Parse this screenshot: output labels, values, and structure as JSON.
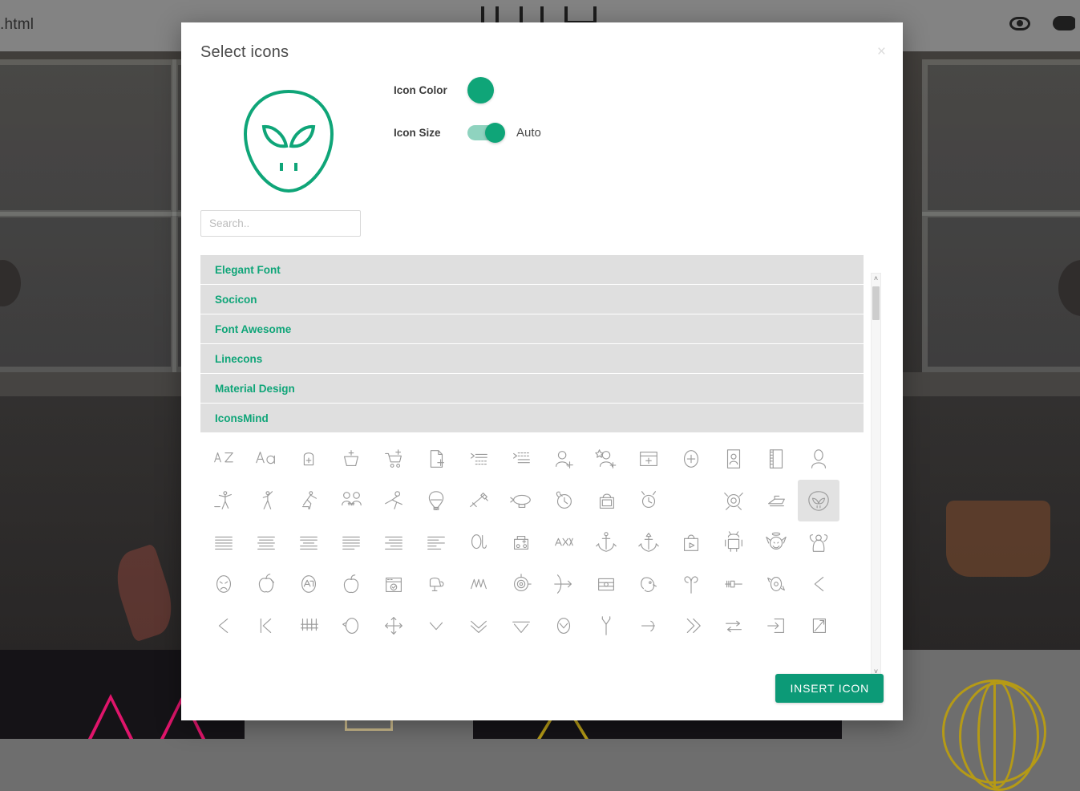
{
  "background": {
    "browser_title": ".html",
    "device_icons": [
      "mobile-preview-icon",
      "tablet-preview-icon",
      "desktop-preview-icon"
    ],
    "toolbar_icons": [
      "eye-icon",
      "cloud-icon"
    ]
  },
  "modal": {
    "title": "Select icons",
    "close_label": "×",
    "preview": {
      "icon_name": "alien-icon",
      "color": "#0fa578"
    },
    "options": {
      "color_label": "Icon Color",
      "color_value": "#0fa578",
      "size_label": "Icon Size",
      "size_value": "Auto",
      "size_toggle_on": true
    },
    "search": {
      "placeholder": "Search..",
      "value": ""
    },
    "categories": [
      {
        "label": "Elegant Font"
      },
      {
        "label": "Socicon"
      },
      {
        "label": "Font Awesome"
      },
      {
        "label": "Linecons"
      },
      {
        "label": "Material Design"
      },
      {
        "label": "IconsMind"
      }
    ],
    "icon_grid": {
      "selected_index": 29,
      "icons": [
        "a-to-z-sort-icon",
        "font-size-icon",
        "add-bag-icon",
        "add-basket-icon",
        "add-cart-icon",
        "add-file-icon",
        "add-space-before-paragraph-icon",
        "add-space-after-paragraph-icon",
        "add-user-icon",
        "add-favorite-user-icon",
        "add-window-icon",
        "add-circle-icon",
        "address-book-icon",
        "agenda-icon",
        "administrator-icon",
        "aerobics-icon",
        "aerobics-2-icon",
        "aerobics-3-icon",
        "affiliate-icon",
        "air-balloon-icon",
        "hot-air-balloon-icon",
        "airship-icon",
        "aircraft-icon",
        "alarm-clock-icon",
        "alarm-bag-icon",
        "alarm-clock-2-icon",
        "alien-icon",
        "alien-2-icon",
        "alien-ship-icon",
        "align-justify-all-icon",
        "align-justify-all-2-icon",
        "align-justify-center-icon",
        "align-justify-high-icon",
        "align-justify-low-icon",
        "align-justify-right-icon",
        "align-left-icon",
        "align-right-icon",
        "alpha-icon",
        "ambulance-icon",
        "amx-icon",
        "anchor-icon",
        "anchor-2-icon",
        "android-store-icon",
        "android-icon",
        "angel-smile-icon",
        "angel-icon",
        "angry-icon",
        "apple-bite-icon",
        "apple-store-icon",
        "apple-icon",
        "approved-window-icon",
        "aquarius-icon",
        "arrow-around-icon",
        "archery-icon",
        "archery-2-icon",
        "argentina-icon",
        "aries-icon",
        "arrow-back-icon",
        "arrow-refresh-icon",
        "arrow-left-icon",
        "arrow-back-3-icon",
        "arrow-back-2-icon",
        "arrow-barrier-icon",
        "arrow-circle-icon",
        "arrow-cross-icon",
        "arrow-down-icon",
        "arrow-down-2-icon",
        "arrow-down-3-icon",
        "arrow-down-in-circle-icon",
        "arrow-fork-icon",
        "arrow-forward-icon",
        "arrow-forward-2-icon",
        "arrow-turn-right-icon",
        "arrow-into-icon",
        "arrow-inside-icon",
        "arrow-next-icon",
        "arrow-slash-icon",
        "arrow-merge-icon",
        "arrow-slash-2-icon",
        "arrow-double-slash-icon",
        "arrow-over-icon",
        "arrow-turn-icon",
        "arrow-dot-icon",
        "arrow-in-out-icon",
        "arrow-parallel-icon",
        "arrow-corner-icon"
      ]
    },
    "scrollbar": {
      "up_arrow": "˄",
      "down_arrow": "˅"
    },
    "insert_button_label": "INSERT ICON"
  }
}
